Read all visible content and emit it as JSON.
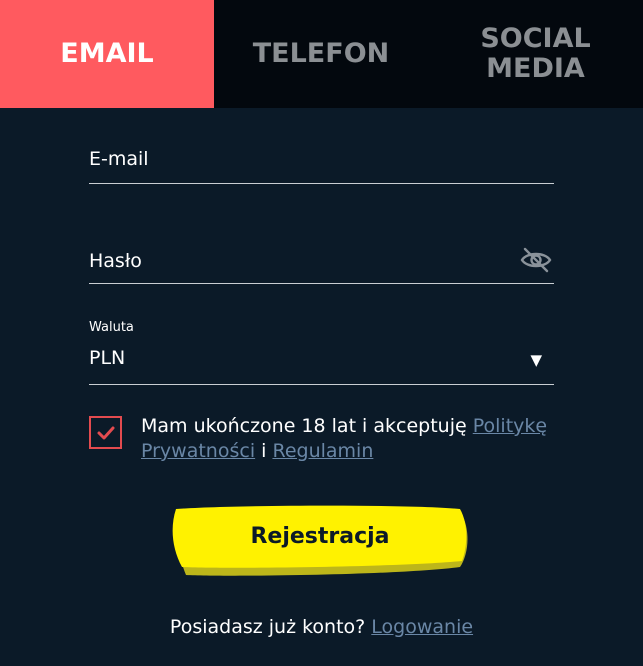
{
  "tabs": [
    {
      "label": "EMAIL",
      "active": true
    },
    {
      "label": "TELEFON",
      "active": false
    },
    {
      "label": "SOCIAL\nMEDIA",
      "active": false
    }
  ],
  "form": {
    "email_placeholder": "E-mail",
    "password_placeholder": "Hasło",
    "password_toggle_icon": "eye-off-icon",
    "currency_label": "Waluta",
    "currency_value": "PLN",
    "currency_caret": "▼"
  },
  "consent": {
    "checked": true,
    "text_before": "Mam ukończone 18 lat i akceptuję ",
    "privacy_link": "Politykę Prywatności",
    "conjunction": " i ",
    "terms_link": "Regulamin"
  },
  "register_button": {
    "label": "Rejestracja",
    "color": "#fff200"
  },
  "login": {
    "prompt": "Posiadasz już konto? ",
    "link": "Logowanie"
  },
  "colors": {
    "background": "#0b1a28",
    "tab_bar": "#03080e",
    "active_tab": "#ff5a5f",
    "checkbox": "#e34b4f",
    "link": "#6a87a6"
  }
}
